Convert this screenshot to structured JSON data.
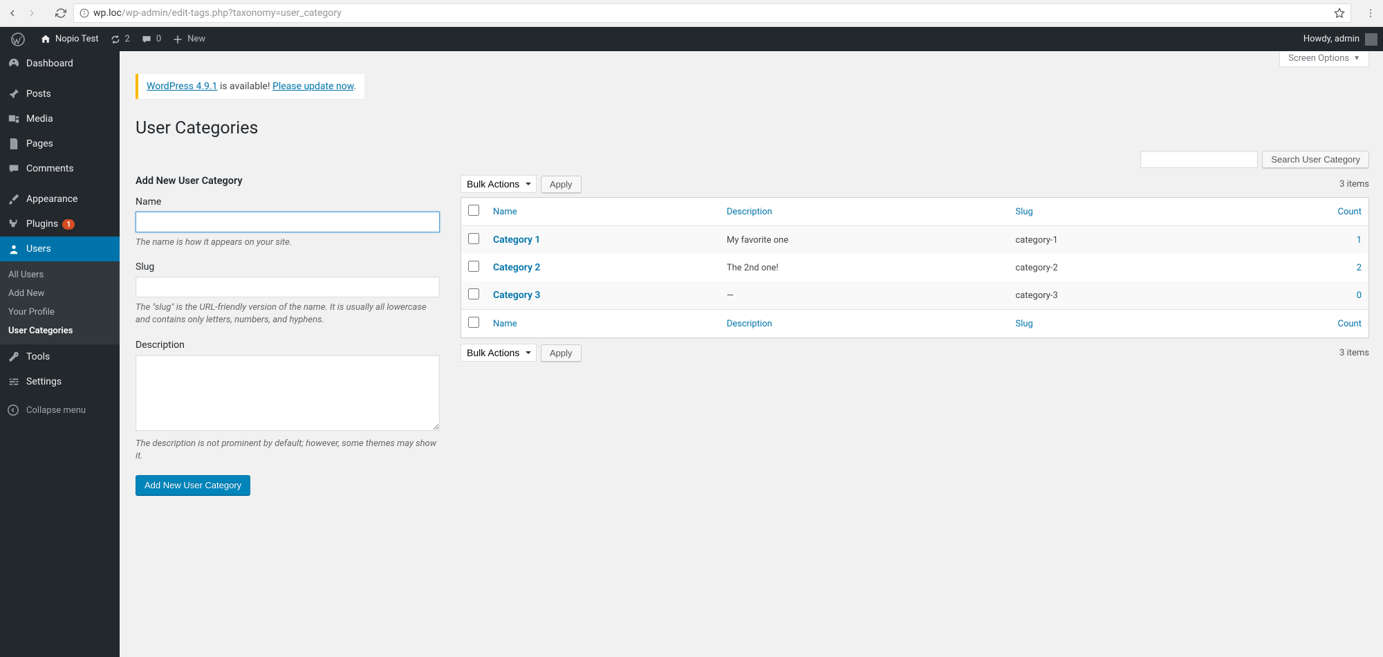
{
  "browser": {
    "url_host": "wp.loc",
    "url_path": "/wp-admin/edit-tags.php?taxonomy=user_category"
  },
  "admin_bar": {
    "site_name": "Nopio Test",
    "updates": "2",
    "comments": "0",
    "new_label": "New",
    "howdy": "Howdy, admin"
  },
  "sidebar": {
    "dashboard": "Dashboard",
    "posts": "Posts",
    "media": "Media",
    "pages": "Pages",
    "comments": "Comments",
    "appearance": "Appearance",
    "plugins": "Plugins",
    "plugins_badge": "1",
    "users": "Users",
    "tools": "Tools",
    "settings": "Settings",
    "collapse": "Collapse menu",
    "submenu": {
      "all_users": "All Users",
      "add_new": "Add New",
      "your_profile": "Your Profile",
      "user_categories": "User Categories"
    }
  },
  "screen_options": "Screen Options",
  "notice": {
    "link1": "WordPress 4.9.1",
    "mid": " is available! ",
    "link2": "Please update now",
    "end": "."
  },
  "page_title": "User Categories",
  "form": {
    "heading": "Add New User Category",
    "name_label": "Name",
    "name_help": "The name is how it appears on your site.",
    "slug_label": "Slug",
    "slug_help": "The \"slug\" is the URL-friendly version of the name. It is usually all lowercase and contains only letters, numbers, and hyphens.",
    "desc_label": "Description",
    "desc_help": "The description is not prominent by default; however, some themes may show it.",
    "submit": "Add New User Category"
  },
  "search": {
    "button": "Search User Category"
  },
  "bulk": {
    "label": "Bulk Actions",
    "apply": "Apply"
  },
  "pagination": {
    "count": "3 items"
  },
  "table": {
    "headers": {
      "name": "Name",
      "description": "Description",
      "slug": "Slug",
      "count": "Count"
    },
    "rows": [
      {
        "name": "Category 1",
        "description": "My favorite one",
        "slug": "category-1",
        "count": "1"
      },
      {
        "name": "Category 2",
        "description": "The 2nd one!",
        "slug": "category-2",
        "count": "2"
      },
      {
        "name": "Category 3",
        "description": "—",
        "slug": "category-3",
        "count": "0"
      }
    ]
  }
}
